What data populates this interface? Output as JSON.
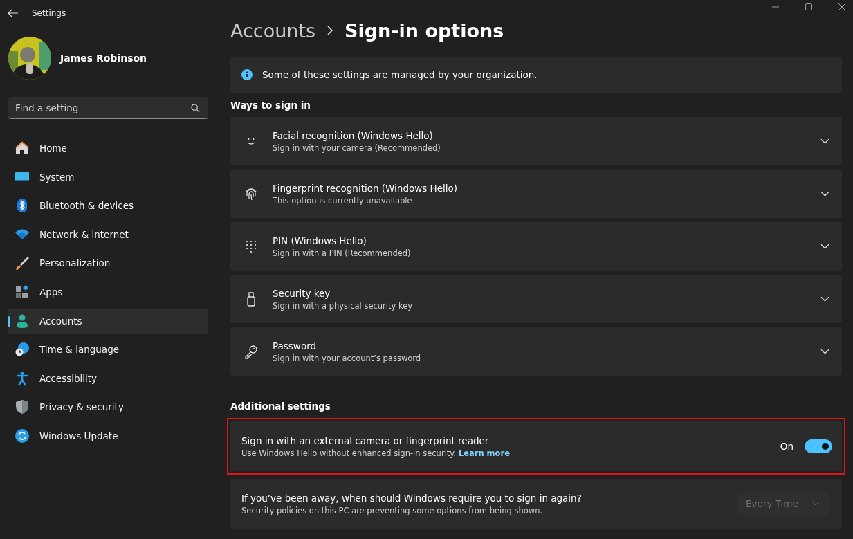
{
  "window": {
    "title": "Settings"
  },
  "user": {
    "name": "James Robinson"
  },
  "search": {
    "placeholder": "Find a setting"
  },
  "nav": [
    {
      "kind": "home",
      "label": "Home",
      "selected": false
    },
    {
      "kind": "system",
      "label": "System",
      "selected": false
    },
    {
      "kind": "bluetooth",
      "label": "Bluetooth & devices",
      "selected": false
    },
    {
      "kind": "network",
      "label": "Network & internet",
      "selected": false
    },
    {
      "kind": "personalization",
      "label": "Personalization",
      "selected": false
    },
    {
      "kind": "apps",
      "label": "Apps",
      "selected": false
    },
    {
      "kind": "accounts",
      "label": "Accounts",
      "selected": true
    },
    {
      "kind": "time",
      "label": "Time & language",
      "selected": false
    },
    {
      "kind": "accessibility",
      "label": "Accessibility",
      "selected": false
    },
    {
      "kind": "privacy",
      "label": "Privacy & security",
      "selected": false
    },
    {
      "kind": "update",
      "label": "Windows Update",
      "selected": false
    }
  ],
  "breadcrumb": {
    "parent": "Accounts",
    "current": "Sign-in options"
  },
  "banner": {
    "text": "Some of these settings are managed by your organization."
  },
  "ways": {
    "heading": "Ways to sign in",
    "items": [
      {
        "kind": "face",
        "title": "Facial recognition (Windows Hello)",
        "subtitle": "Sign in with your camera (Recommended)",
        "expanded": false
      },
      {
        "kind": "fingerprint",
        "title": "Fingerprint recognition (Windows Hello)",
        "subtitle": "This option is currently unavailable",
        "expanded": false
      },
      {
        "kind": "pin",
        "title": "PIN (Windows Hello)",
        "subtitle": "Sign in with a PIN (Recommended)",
        "expanded": false
      },
      {
        "kind": "key",
        "title": "Security key",
        "subtitle": "Sign in with a physical security key",
        "expanded": false
      },
      {
        "kind": "password",
        "title": "Password",
        "subtitle": "Sign in with your account’s password",
        "expanded": false
      }
    ]
  },
  "additional": {
    "heading": "Additional settings",
    "toggle_row": {
      "title": "Sign in with an external camera or fingerprint reader",
      "description": "Use Windows Hello without enhanced sign-in security.",
      "link": "Learn more",
      "state_label": "On",
      "on": true,
      "highlighted": true
    },
    "dropdown_row": {
      "title": "If you’ve been away, when should Windows require you to sign in again?",
      "description": "Security policies on this PC are preventing some options from being shown.",
      "value": "Every Time",
      "disabled": true
    }
  }
}
